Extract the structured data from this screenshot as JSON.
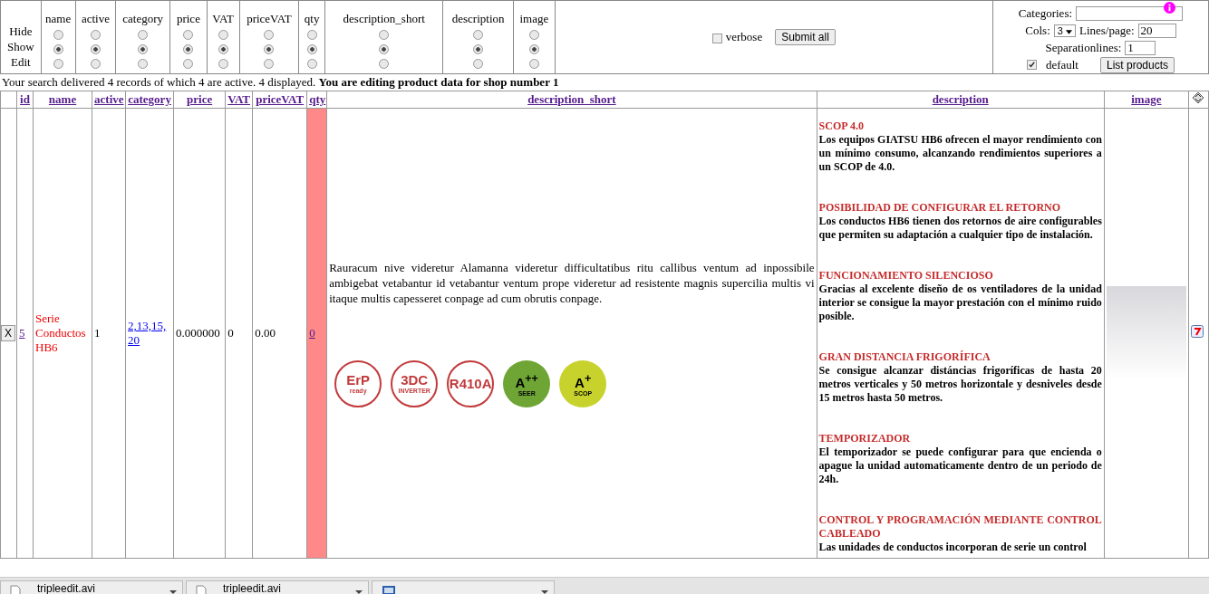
{
  "view_controls": {
    "mode_labels": [
      "Hide",
      "Show",
      "Edit"
    ],
    "columns": [
      {
        "label": "name",
        "hide": false,
        "show": true,
        "edit": false
      },
      {
        "label": "active",
        "hide": false,
        "show": true,
        "edit": false
      },
      {
        "label": "category",
        "hide": false,
        "show": true,
        "edit": false
      },
      {
        "label": "price",
        "hide": false,
        "show": true,
        "edit": false
      },
      {
        "label": "VAT",
        "hide": false,
        "show": true,
        "edit": false
      },
      {
        "label": "priceVAT",
        "hide": false,
        "show": true,
        "edit": false
      },
      {
        "label": "qty",
        "hide": false,
        "show": true,
        "edit": false
      },
      {
        "label": "description_short",
        "hide": false,
        "show": true,
        "edit": false
      },
      {
        "label": "description",
        "hide": false,
        "show": true,
        "edit": false
      },
      {
        "label": "image",
        "hide": false,
        "show": true,
        "edit": false
      }
    ],
    "verbose": {
      "label": "verbose",
      "checked": false
    },
    "submit_button": "Submit all"
  },
  "list_options": {
    "categories_label": "Categories:",
    "cols_label": "Cols:",
    "cols_value": "3",
    "lines_label": "Lines/page:",
    "lines_value": "20",
    "separation_label": "Separationlines:",
    "separation_value": "1",
    "default": {
      "label": "default",
      "checked": true
    },
    "list_button": "List products"
  },
  "summary": "Your search delivered 4 records of which 4 are active. 4 displayed. **You are editing product data for shop number 1**",
  "table": {
    "columns": [
      "id",
      "name",
      "active",
      "category",
      "price",
      "VAT",
      "priceVAT",
      "qty",
      "description_short",
      "description",
      "image"
    ],
    "rows": [
      {
        "delete_button": "X",
        "id": "5",
        "name": "Serie Conductos HB6",
        "active": "1",
        "category": "2,13,15,20",
        "price": "0.000000",
        "VAT": "0",
        "priceVAT": "0.00",
        "qty": "0",
        "qty_flagged": true,
        "description_short": "Rauracum nive videretur Alamanna videretur difficultatibus ritu callibus ventum ad inpossibile ambigebat vetabantur id vetabantur ventum prope videretur ad resistente magnis supercilia multis vi itaque multis capesseret conpage ad cum obrutis conpage.",
        "badges": [
          {
            "kind": "outline",
            "top": "ErP",
            "bottom": "ready",
            "color": "#c23b3c"
          },
          {
            "kind": "outline",
            "top": "3DC",
            "bottom": "INVERTER",
            "color": "#c23b3c"
          },
          {
            "kind": "outline",
            "top": "R410A",
            "color": "#c23b3c"
          },
          {
            "kind": "filled",
            "top": "A$^{++}$",
            "bottom": "SEER",
            "color": "#6ea535"
          },
          {
            "kind": "filled",
            "top": "A$^{+}$",
            "bottom": "SCOP",
            "color": "#c8d22c"
          }
        ],
        "description": [
          {
            "title": "SCOP 4.0",
            "body": "Los equipos GIATSU HB6 ofrecen el mayor rendimiento con un mínimo consumo, alcanzando rendimientos superiores a un SCOP de 4.0."
          },
          {
            "title": "POSIBILIDAD DE CONFIGURAR EL RETORNO",
            "body": "Los conductos HB6 tienen dos retornos de aire configurables que permiten su adaptación a cualquier tipo de instalación."
          },
          {
            "title": "FUNCIONAMIENTO SILENCIOSO",
            "body": "Gracias al excelente diseño de os ventiladores de la unidad interior se consigue la mayor prestación con el mínimo ruido posible."
          },
          {
            "title": "GRAN DISTANCIA FRIGORÍFICA",
            "body": "Se consigue alcanzar distáncias frigoríficas de hasta 20 metros verticales y 50 metros horizontale y desniveles desde 15 metros hasta 50 metros."
          },
          {
            "title": "TEMPORIZADOR",
            "body": "El temporizador se puede configurar para que encienda o apague la unidad automaticamente dentro de un periodo de 24h."
          },
          {
            "title": "CONTROL Y PROGRAMACIÓN MEDIANTE CONTROL CABLEADO",
            "body": "Las unidades de conductos incorporan de serie un control"
          }
        ]
      }
    ]
  },
  "downloads": [
    {
      "kind": "document",
      "name": "tripleedit.avi"
    },
    {
      "kind": "document",
      "name": "tripleedit.avi"
    },
    {
      "kind": "video"
    }
  ]
}
